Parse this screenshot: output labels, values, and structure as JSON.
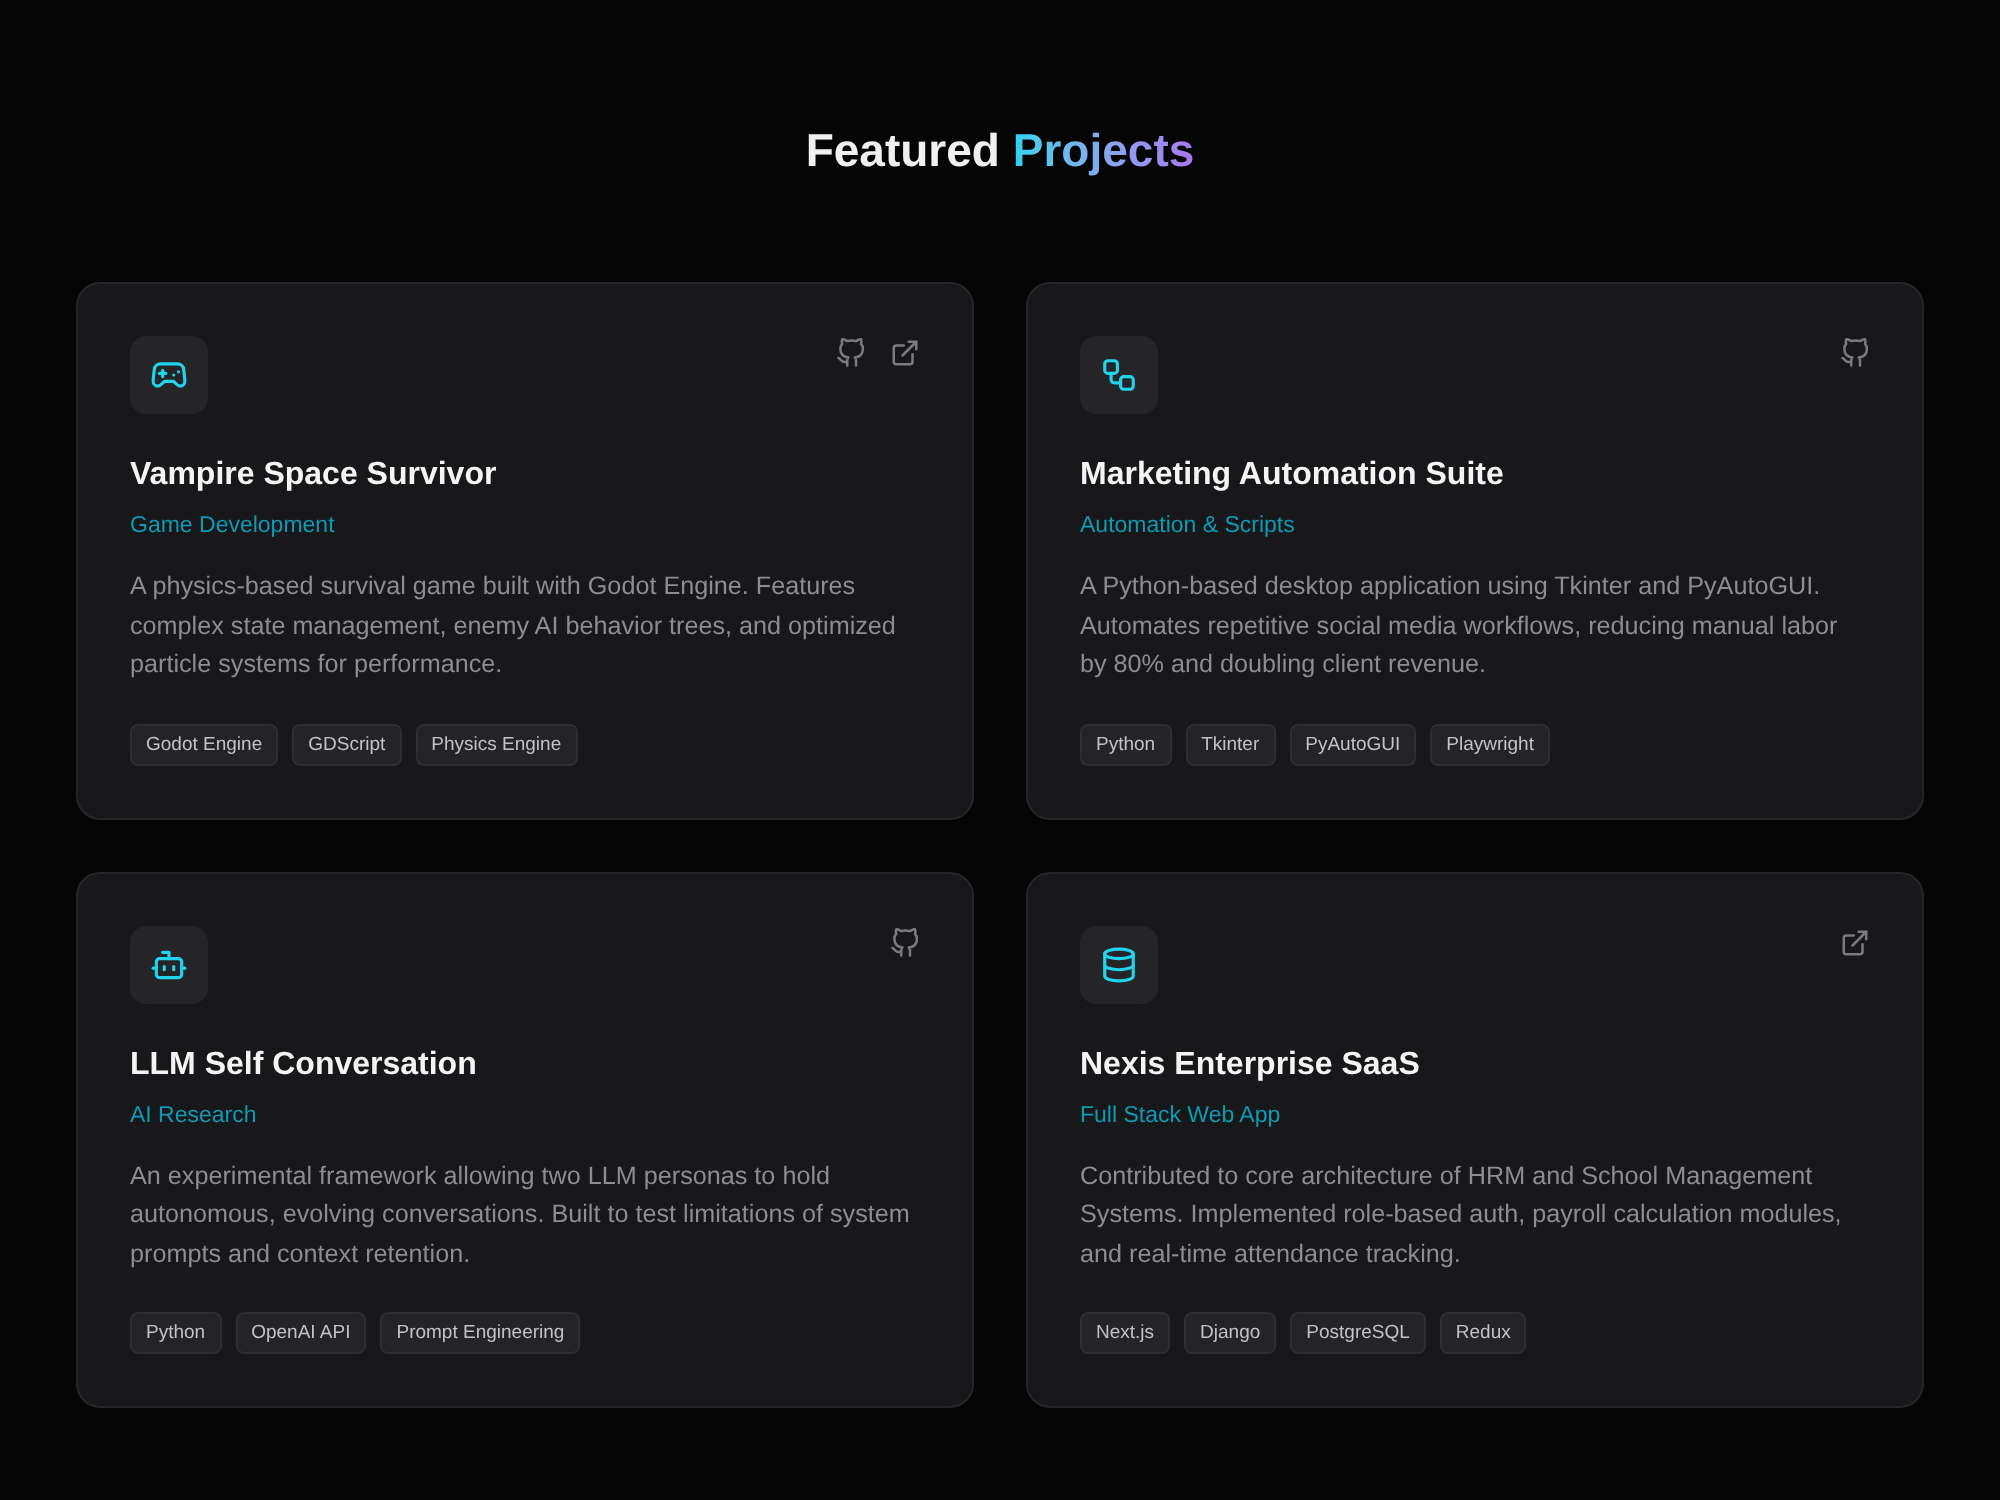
{
  "heading": {
    "text": "Featured",
    "highlight": "Projects"
  },
  "projects": [
    {
      "kind": "game",
      "title": "Vampire Space Survivor",
      "category": "Game Development",
      "description": "A physics-based survival game built with Godot Engine. Features complex state management, enemy AI behavior trees, and optimized particle systems for performance.",
      "tags": [
        "Godot Engine",
        "GDScript",
        "Physics Engine"
      ],
      "links": {
        "github": true,
        "external": true
      }
    },
    {
      "kind": "automation",
      "title": "Marketing Automation Suite",
      "category": "Automation & Scripts",
      "description": "A Python-based desktop application using Tkinter and PyAutoGUI. Automates repetitive social media workflows, reducing manual labor by 80% and doubling client revenue.",
      "tags": [
        "Python",
        "Tkinter",
        "PyAutoGUI",
        "Playwright"
      ],
      "links": {
        "github": true,
        "external": false
      }
    },
    {
      "kind": "ai",
      "title": "LLM Self Conversation",
      "category": "AI Research",
      "description": "An experimental framework allowing two LLM personas to hold autonomous, evolving conversations. Built to test limitations of system prompts and context retention.",
      "tags": [
        "Python",
        "OpenAI API",
        "Prompt Engineering"
      ],
      "links": {
        "github": true,
        "external": false
      }
    },
    {
      "kind": "web",
      "title": "Nexis Enterprise SaaS",
      "category": "Full Stack Web App",
      "description": "Contributed to core architecture of HRM and School Management Systems. Implemented role-based auth, payroll calculation modules, and real-time attendance tracking.",
      "tags": [
        "Next.js",
        "Django",
        "PostgreSQL",
        "Redux"
      ],
      "links": {
        "github": false,
        "external": true
      }
    }
  ]
}
